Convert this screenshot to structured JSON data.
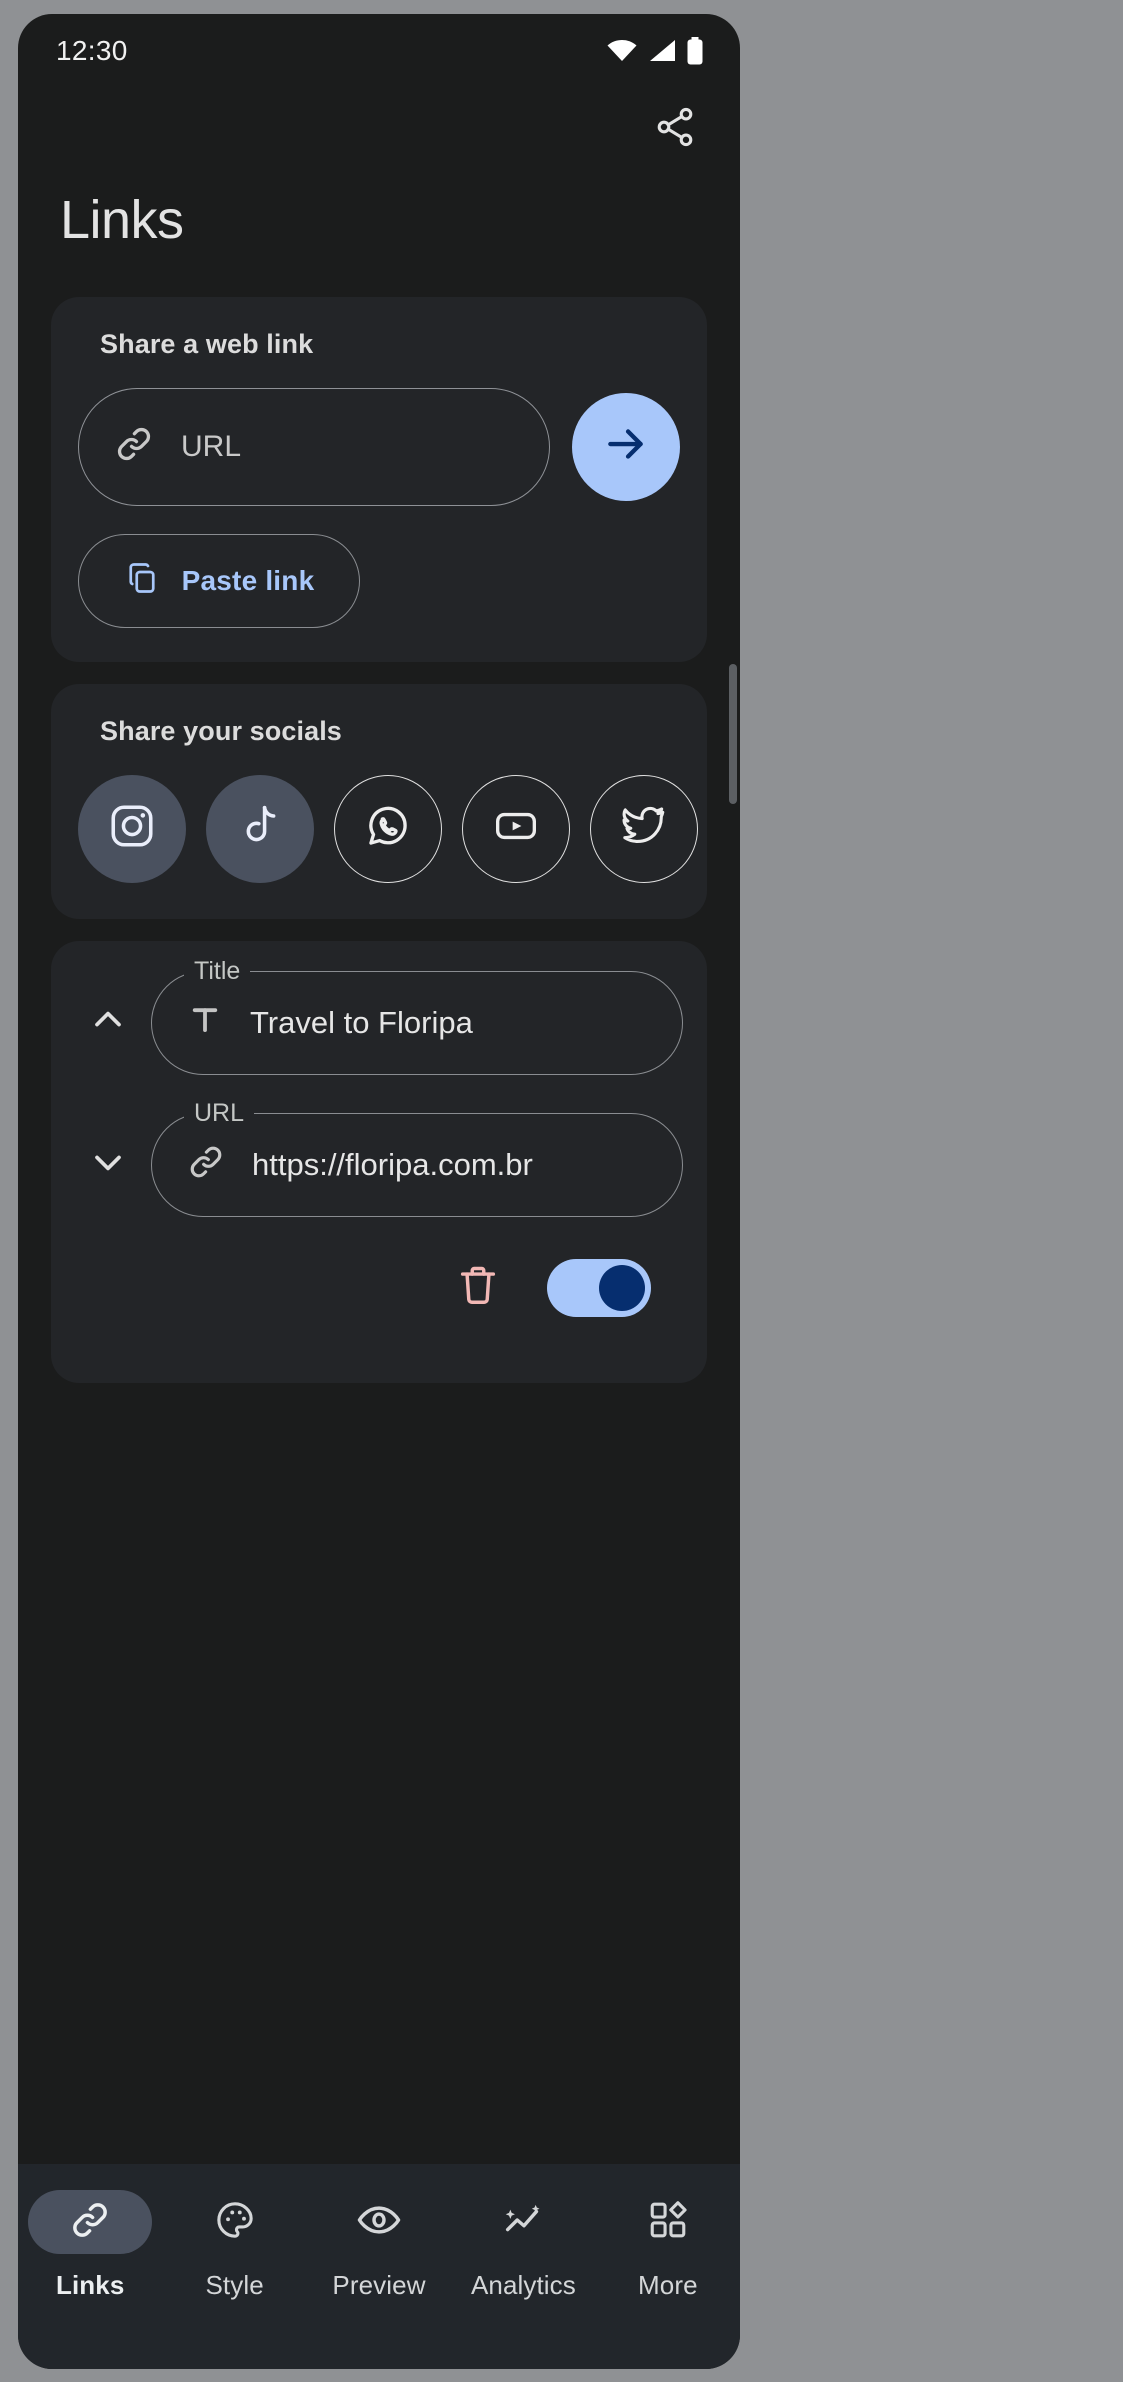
{
  "status_bar": {
    "time": "12:30",
    "icons": [
      "wifi-icon",
      "cellular-signal-icon",
      "battery-icon"
    ]
  },
  "app_bar": {
    "share_icon": "share-icon"
  },
  "page_title": "Links",
  "web_link_card": {
    "heading": "Share a web link",
    "url_input": {
      "placeholder": "URL",
      "value": "",
      "icon": "link-icon"
    },
    "submit_icon": "arrow-right-icon",
    "paste_button": {
      "label": "Paste link",
      "icon": "copy-icon"
    }
  },
  "socials_card": {
    "heading": "Share your socials",
    "items": [
      {
        "name": "Instagram",
        "icon": "instagram-icon",
        "selected": true
      },
      {
        "name": "TikTok",
        "icon": "tiktok-icon",
        "selected": true
      },
      {
        "name": "WhatsApp",
        "icon": "whatsapp-icon",
        "selected": false
      },
      {
        "name": "YouTube",
        "icon": "youtube-icon",
        "selected": false
      },
      {
        "name": "Twitter",
        "icon": "twitter-icon",
        "selected": false
      }
    ]
  },
  "link_item_card": {
    "collapse_icon": "chevron-up-icon",
    "expand_icon": "chevron-down-icon",
    "title_field": {
      "label": "Title",
      "value": "Travel to Floripa",
      "icon": "text-format-icon"
    },
    "url_field": {
      "label": "URL",
      "value": "https://floripa.com.br",
      "icon": "link-icon"
    },
    "delete_icon": "trash-icon",
    "toggle": {
      "name": "visibility-toggle",
      "on": true
    }
  },
  "bottom_nav": {
    "items": [
      {
        "label": "Links",
        "icon": "link-icon",
        "active": true
      },
      {
        "label": "Style",
        "icon": "palette-icon",
        "active": false
      },
      {
        "label": "Preview",
        "icon": "eye-icon",
        "active": false
      },
      {
        "label": "Analytics",
        "icon": "analytics-sparkle-icon",
        "active": false
      },
      {
        "label": "More",
        "icon": "grid-more-icon",
        "active": false
      }
    ]
  },
  "colors": {
    "accent": "#a8c7fa",
    "accent_dark": "#062e6f",
    "card": "#232528",
    "background": "#1b1c1c",
    "nav_bar": "#22262b",
    "selected_chip": "#4a515f",
    "danger": "#f2b8b5",
    "outline": "#8a8d91",
    "text_primary": "#e3e3e3"
  }
}
